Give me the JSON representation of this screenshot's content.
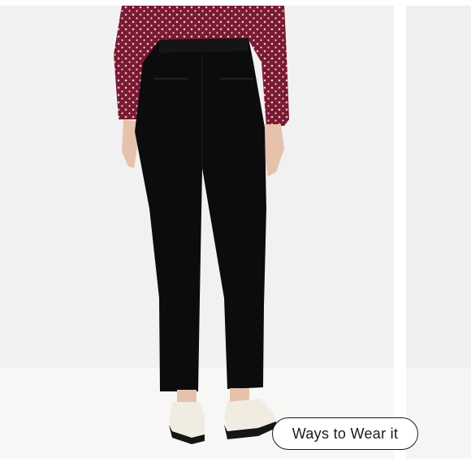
{
  "gallery": {
    "main_image_icon": "product-photo",
    "next_image_icon": "product-photo-preview",
    "ways_to_wear_label": "Ways to Wear it"
  },
  "colors": {
    "pants": "#0c0c0e",
    "blouse": "#7a1a33",
    "blouse_dots": "#e8c9c8",
    "background": "#f1f1f1",
    "button_border": "#1a1a1a"
  }
}
